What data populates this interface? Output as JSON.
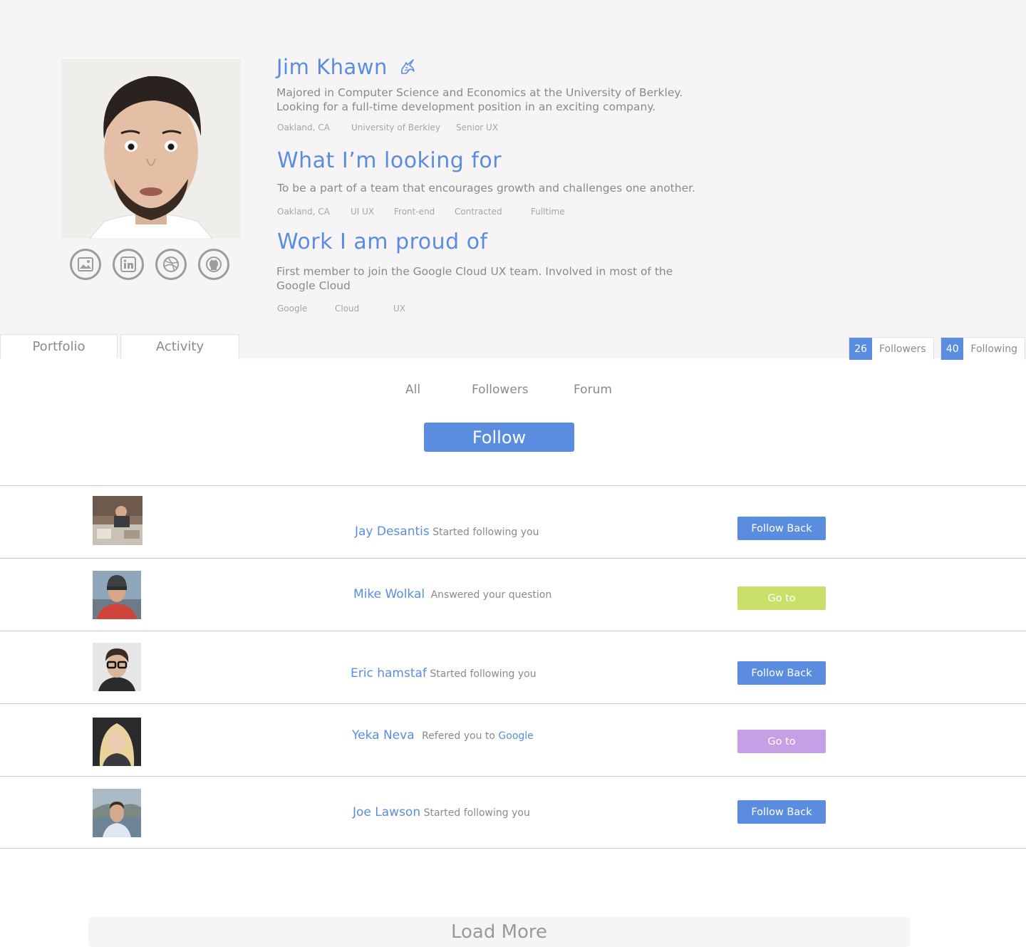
{
  "profile": {
    "name": "Jim Khawn",
    "bio_line1": "Majored in Computer Science and Economics at the University of Berkley.",
    "bio_line2": "Looking for a full-time development position in an exciting company.",
    "bio_tags": [
      "Oakland, CA",
      "University of Berkley",
      "Senior UX"
    ],
    "looking_title": "What I’m looking for",
    "looking_text": "To be a part of a team that encourages growth and challenges one another.",
    "looking_tags": [
      "Oakland, CA",
      "UI UX",
      "Front-end",
      "Contracted",
      "Fulltime"
    ],
    "work_title": "Work I am proud of",
    "work_line1": "First member to join the Google Cloud UX team. Involved in most of the",
    "work_line2": "Google Cloud",
    "work_tags": [
      "Google",
      "Cloud",
      "UX"
    ],
    "social_icons": [
      "image-icon",
      "linkedin-icon",
      "dribbble-icon",
      "github-icon"
    ]
  },
  "tabs": [
    "Portfolio",
    "Activity"
  ],
  "stats": {
    "followers_count": "26",
    "followers_label": "Followers",
    "following_count": "40",
    "following_label": "Following"
  },
  "filters": [
    "All",
    "Followers",
    "Forum"
  ],
  "follow_button": "Follow",
  "activity": [
    {
      "name": "Jay Desantis",
      "action": "Started following you",
      "target": "",
      "button": "Follow Back",
      "button_color": "#5a8de0"
    },
    {
      "name": "Mike Wolkal",
      "action": "Answered your question",
      "target": "",
      "button": "Go to",
      "button_color": "#c8e06a"
    },
    {
      "name": "Eric hamstaf",
      "action": "Started following you",
      "target": "",
      "button": "Follow Back",
      "button_color": "#5a8de0"
    },
    {
      "name": "Yeka Neva",
      "action": "Refered you to",
      "target": "Google",
      "button": "Go to",
      "button_color": "#c6a0e6"
    },
    {
      "name": "Joe Lawson",
      "action": "Started following you",
      "target": "",
      "button": "Follow Back",
      "button_color": "#5a8de0"
    }
  ],
  "load_more": "Load More",
  "colors": {
    "accent": "#5a8de0",
    "panel_bg": "#f6f4f5",
    "green": "#c8e06a",
    "purple": "#c6a0e6"
  }
}
